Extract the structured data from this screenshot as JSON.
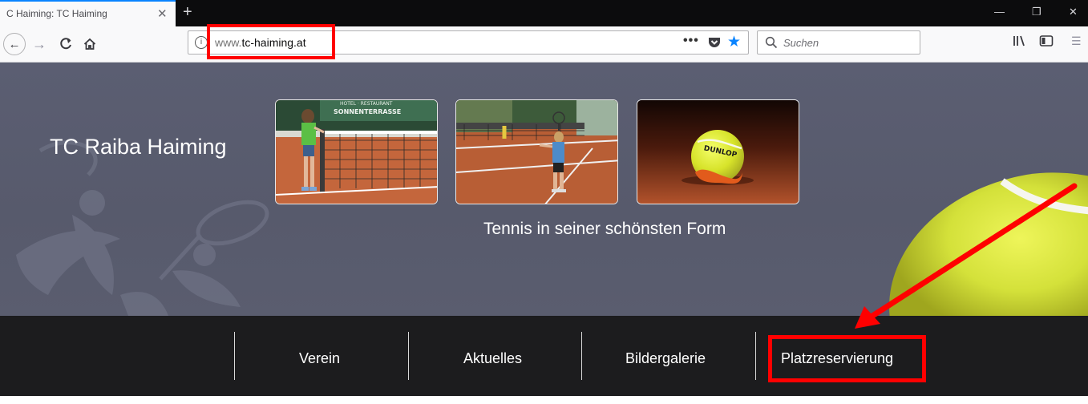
{
  "browser": {
    "tab_title": "C Haiming: TC Haiming",
    "tab_close": "✕",
    "new_tab": "+",
    "url_prefix": "www.",
    "url_domain": "tc-haiming.at",
    "url_more": "•••",
    "search_placeholder": "Suchen",
    "accent_color": "#0a84ff",
    "icons": [
      "back-icon",
      "forward-icon",
      "reload-icon",
      "home-icon",
      "info-icon",
      "pocket-icon",
      "star-icon",
      "search-icon",
      "library-icon",
      "sidebar-icon",
      "menu-icon"
    ]
  },
  "site": {
    "title": "TC Raiba Haiming",
    "tagline": "Tennis in seiner schönsten Form",
    "photos": [
      {
        "sign_line1": "HOTEL · RESTAURANT",
        "sign_line2": "SONNENTERRASSE"
      },
      {},
      {
        "ball_text": "DUNLOP"
      }
    ],
    "nav": [
      "Verein",
      "Aktuelles",
      "Bildergalerie",
      "Platzreservierung"
    ]
  },
  "annotations": {
    "highlight_color": "#ff0000",
    "highlighted": [
      "url-bar-text",
      "nav-platzreservierung"
    ]
  }
}
